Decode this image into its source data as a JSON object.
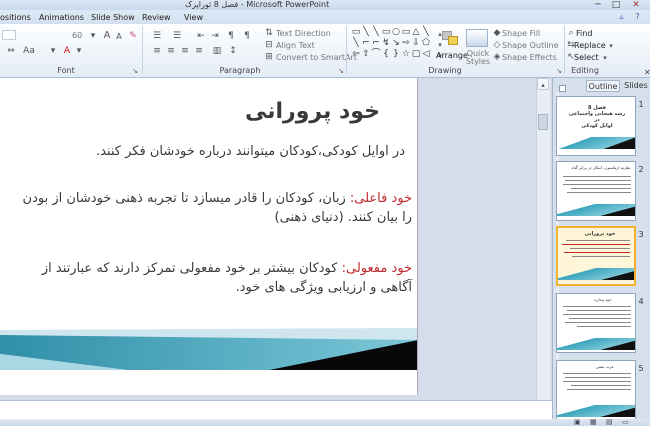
{
  "window": {
    "title": "فصل 8 ئوراپرک - Microsoft PowerPoint",
    "controls": [
      "─",
      "□",
      "✕"
    ]
  },
  "ribbon_tabs": [
    "ositions",
    "Animations",
    "Slide Show",
    "Review",
    "View"
  ],
  "ribbon": {
    "font": {
      "group_label": "Font",
      "size_value": "60",
      "grow": "A",
      "shrink": "A"
    },
    "paragraph": {
      "group_label": "Paragraph",
      "text_direction": "Text Direction",
      "align_text": "Align Text",
      "convert_smartart": "Convert to SmartArt"
    },
    "drawing": {
      "group_label": "Drawing",
      "arrange": "Arrange",
      "quick_styles": "Quick Styles",
      "shape_fill": "Shape Fill",
      "shape_outline": "Shape Outline",
      "shape_effects": "Shape Effects",
      "shapes": [
        "▭",
        "╲",
        "╲",
        "▭",
        "○",
        "▭",
        "△",
        "╲",
        "╲",
        "⌐",
        "⌐",
        "↯",
        "↘",
        "⇨",
        "⇩",
        "⬠",
        "⇦",
        "⇧",
        "⌒",
        "{",
        "}",
        "☆",
        "▢",
        "◁"
      ]
    },
    "editing": {
      "group_label": "Editing",
      "find": "Find",
      "replace": "Replace",
      "select": "Select"
    }
  },
  "slide": {
    "title": "خود پرورانی",
    "line1": "در اوایل کودکی،کودکان میتوانند درباره خودشان فکر کنند.",
    "p2_term": "خود فاعلی:",
    "p2_text": " زبان، کودکان را قادر میسازد تا تجربه ذهنی خودشان از بودن را بیان کنند. (دنیای ذهنی)",
    "p3_term": "خود مفعولی:",
    "p3_text": " کودکان بیشتر بر خود مفعولی تمرکز دارند که عبارتند از آگاهی و ارزیابی ویژگی های خود."
  },
  "pane": {
    "tabs": [
      "Outline",
      "Slides"
    ],
    "close": "✕",
    "thumbnails": [
      {
        "number": "1",
        "title": "فصل 8\nرشد هیجانی واجتماعی در\nاوایل کودکی"
      },
      {
        "number": "2",
        "title": "نظریه اریکسون: ابتکار در برابر گناه"
      },
      {
        "number": "3",
        "title": "خود پرورانی",
        "selected": true
      },
      {
        "number": "4",
        "title": "خود پنداره"
      },
      {
        "number": "5",
        "title": "عزت نفس"
      }
    ]
  },
  "colors": {
    "accent_teal": "#3aa6bd",
    "title_text": "#3a3a3a",
    "term_red": "#c0282d",
    "selection": "#f2b233"
  }
}
